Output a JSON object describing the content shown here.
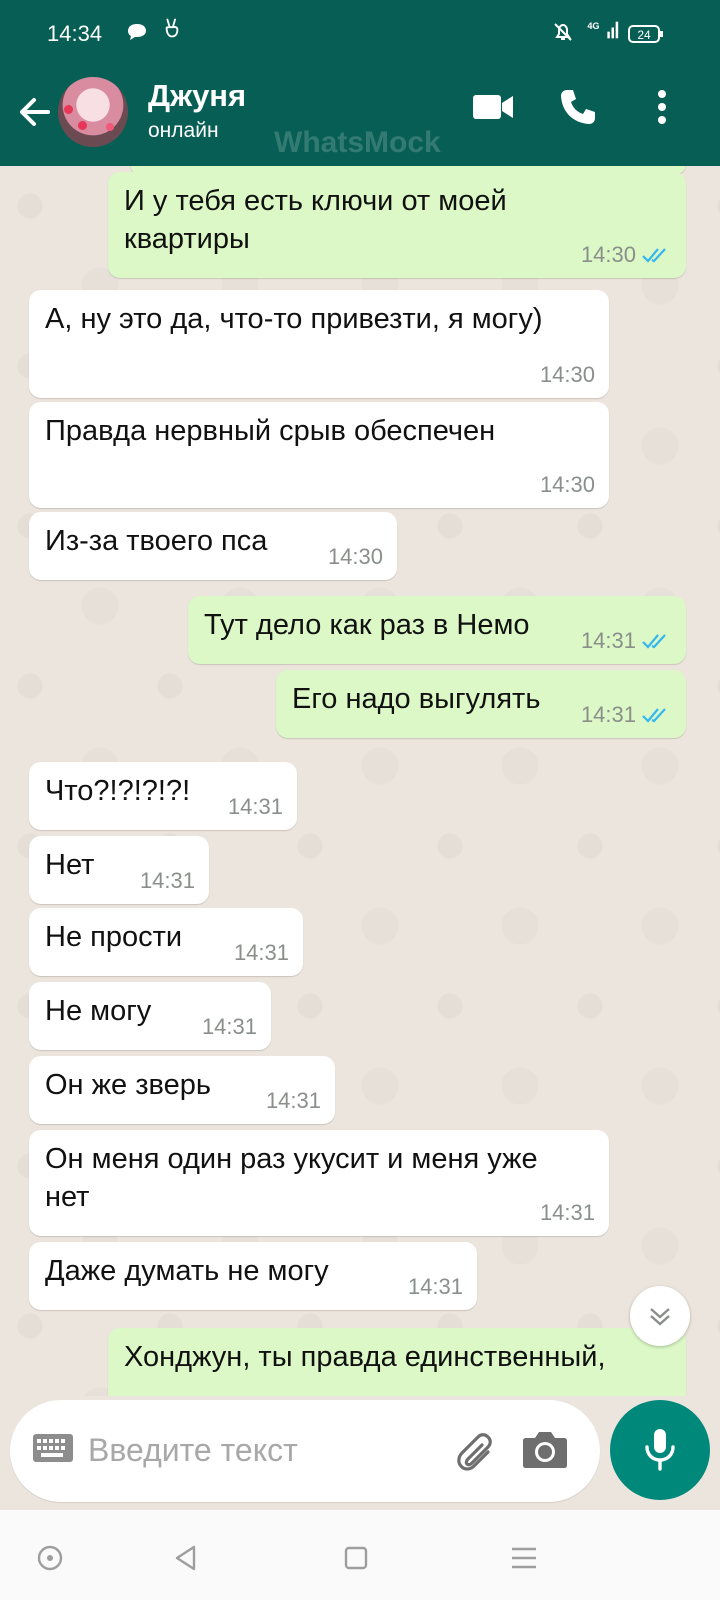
{
  "status_bar": {
    "time": "14:34",
    "network": "4G",
    "battery": "24"
  },
  "header": {
    "contact_name": "Джуня",
    "presence": "онлайн",
    "watermark": "WhatsMock"
  },
  "messages": [
    {
      "dir": "out",
      "text": " И у тебя есть ключи от моей квартиры",
      "time": "14:30",
      "read": true
    },
    {
      "dir": "in",
      "text": "А, ну это да, что-то привезти, я могу)",
      "time": "14:30"
    },
    {
      "dir": "in",
      "text": "Правда нервный срыв обеспечен",
      "time": "14:30"
    },
    {
      "dir": "in",
      "text": "Из-за твоего пса",
      "time": "14:30"
    },
    {
      "dir": "out",
      "text": "Тут дело как раз в Немо",
      "time": "14:31",
      "read": true
    },
    {
      "dir": "out",
      "text": "Его надо выгулять",
      "time": "14:31",
      "read": true
    },
    {
      "dir": "in",
      "text": "Что?!?!?!?!",
      "time": "14:31"
    },
    {
      "dir": "in",
      "text": "Нет",
      "time": "14:31"
    },
    {
      "dir": "in",
      "text": "Не прости",
      "time": "14:31"
    },
    {
      "dir": "in",
      "text": "Не могу",
      "time": "14:31"
    },
    {
      "dir": "in",
      "text": "Он же зверь",
      "time": "14:31"
    },
    {
      "dir": "in",
      "text": "Он меня один раз укусит и меня уже нет",
      "time": "14:31"
    },
    {
      "dir": "in",
      "text": "Даже думать не могу",
      "time": "14:31"
    },
    {
      "dir": "out",
      "text": "Хонджун, ты правда единственный,",
      "time": ""
    }
  ],
  "composer": {
    "placeholder": "Введите текст"
  },
  "colors": {
    "header": "#075e54",
    "outgoing_bubble": "#dcf8c6",
    "incoming_bubble": "#ffffff",
    "read_tick": "#34b7f1",
    "mic_button": "#00897b",
    "chat_bg": "#ece5dd"
  },
  "icons": [
    "message-icon",
    "peace-hand-icon",
    "mute-bell-icon",
    "signal-icon",
    "battery-icon",
    "back-arrow-icon",
    "video-call-icon",
    "phone-icon",
    "more-vert-icon",
    "double-check-icon",
    "chevron-down-icon",
    "keyboard-icon",
    "paperclip-icon",
    "camera-icon",
    "mic-icon",
    "nav-home-icon",
    "nav-back-icon",
    "nav-recents-icon",
    "nav-menu-icon"
  ]
}
